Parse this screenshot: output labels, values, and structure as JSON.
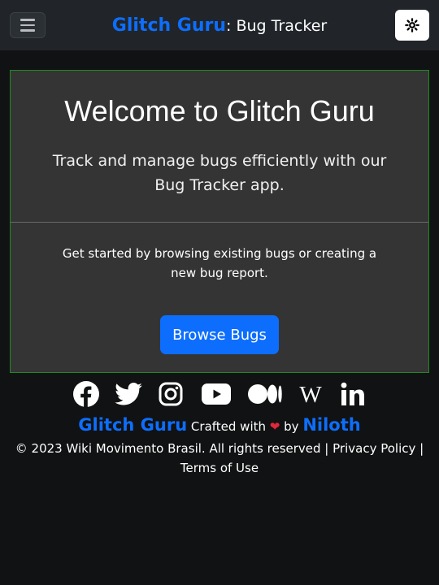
{
  "navbar": {
    "brand_name": "Glitch Guru",
    "brand_suffix": ": Bug Tracker",
    "menu_icon": "hamburger-icon",
    "theme_icon": "sun-gear-icon",
    "bg_color": "#212529"
  },
  "hero": {
    "title": "Welcome to Glitch Guru",
    "lead": "Track and manage bugs efficiently with our Bug Tracker app.",
    "body": "Get started by browsing existing bugs or creating a new bug report.",
    "button_label": "Browse Bugs",
    "border_color": "#1f8a1f",
    "accent_color": "#0d6efd"
  },
  "social": {
    "icons": [
      "facebook-icon",
      "twitter-icon",
      "instagram-icon",
      "youtube-icon",
      "medium-icon",
      "wikipedia-icon",
      "linkedin-icon"
    ]
  },
  "footer": {
    "brand": "Glitch Guru",
    "crafted": "Crafted with",
    "heart": "❤",
    "by": "by",
    "author": "Niloth",
    "copyright": "© 2023 Wiki Movimento Brasil. All rights reserved |",
    "privacy": "Privacy Policy",
    "separator": "|",
    "terms": "Terms of Use"
  }
}
